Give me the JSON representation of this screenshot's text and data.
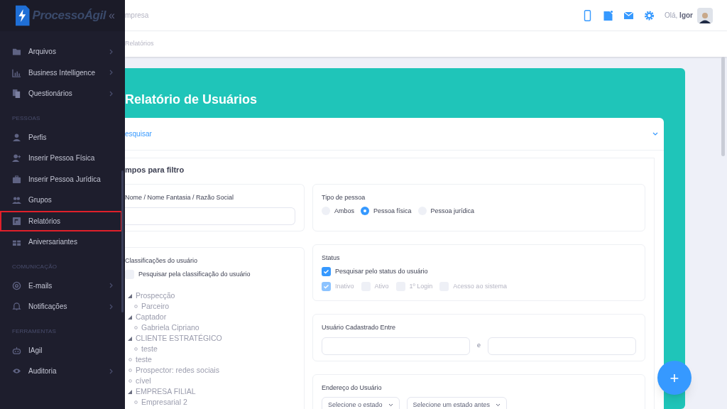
{
  "sidebar": {
    "logo": "ProcessoÁgil",
    "collapse": "«",
    "sections": [
      {
        "items": [
          {
            "label": "Arquivos",
            "submenu": true,
            "selected": false
          },
          {
            "label": "Business Intelligence",
            "submenu": true,
            "selected": false
          },
          {
            "label": "Questionários",
            "submenu": true,
            "selected": false
          }
        ]
      },
      {
        "heading": "PESSOAS",
        "items": [
          {
            "label": "Perfis",
            "submenu": false,
            "selected": false
          },
          {
            "label": "Inserir Pessoa Física",
            "submenu": false,
            "selected": false
          },
          {
            "label": "Inserir Pessoa Jurídica",
            "submenu": false,
            "selected": false
          },
          {
            "label": "Grupos",
            "submenu": false,
            "selected": false
          },
          {
            "label": "Relatórios",
            "submenu": false,
            "selected": true
          },
          {
            "label": "Aniversariantes",
            "submenu": false,
            "selected": false
          }
        ]
      },
      {
        "heading": "COMUNICAÇÃO",
        "items": [
          {
            "label": "E-mails",
            "submenu": true,
            "selected": false
          },
          {
            "label": "Notificações",
            "submenu": true,
            "selected": false
          }
        ]
      },
      {
        "heading": "FERRAMENTAS",
        "items": [
          {
            "label": "IAgil",
            "submenu": false,
            "selected": false
          },
          {
            "label": "Auditoria",
            "submenu": true,
            "selected": false
          }
        ]
      }
    ]
  },
  "header": {
    "company": "mpresa",
    "greeting": "Olá,",
    "user": "Igor"
  },
  "breadcrumb": "Relatórios",
  "page_title": "Relatório de Usuários",
  "search_panel": {
    "title": "esquisar",
    "expanded": true
  },
  "filters": {
    "title": "mpos para filtro",
    "name_field": {
      "label": "Nome / Nome Fantasia / Razão Social"
    },
    "person_type": {
      "label": "Tipo de pessoa",
      "options": [
        {
          "label": "Ambos",
          "selected": false
        },
        {
          "label": "Pessoa física",
          "selected": true
        },
        {
          "label": "Pessoa jurídica",
          "selected": false
        }
      ]
    },
    "classifications": {
      "label": "Classificações do usuário",
      "toggle": {
        "label": "Pesquisar pela classificação do usuário",
        "checked": false
      },
      "tree": [
        {
          "label": "Prospecção",
          "expanded": true,
          "children": [
            {
              "label": "Parceiro"
            }
          ]
        },
        {
          "label": "Captador",
          "expanded": true,
          "children": [
            {
              "label": "Gabriela Cipriano"
            }
          ]
        },
        {
          "label": "CLIENTE ESTRATÉGICO",
          "expanded": true,
          "children": [
            {
              "label": "teste"
            }
          ]
        },
        {
          "label": "teste"
        },
        {
          "label": "Prospector: redes sociais"
        },
        {
          "label": "cível"
        },
        {
          "label": "EMPRESA FILIAL",
          "expanded": true,
          "children": [
            {
              "label": "Empresarial 2"
            }
          ]
        }
      ]
    },
    "status": {
      "label": "Status",
      "toggle": {
        "label": "Pesquisar pelo status do usuário",
        "checked": true
      },
      "options": [
        {
          "label": "Inativo",
          "checked": true
        },
        {
          "label": "Ativo",
          "checked": false
        },
        {
          "label": "1º Login",
          "checked": false
        },
        {
          "label": "Acesso ao sistema",
          "checked": false
        }
      ]
    },
    "registered_between": {
      "label": "Usuário Cadastrado Entre",
      "separator": "e"
    },
    "address": {
      "label": "Endereço do Usuário",
      "state_select": "Selecione o estado",
      "city_select": "Selecione um estado antes"
    }
  },
  "fab": "+"
}
